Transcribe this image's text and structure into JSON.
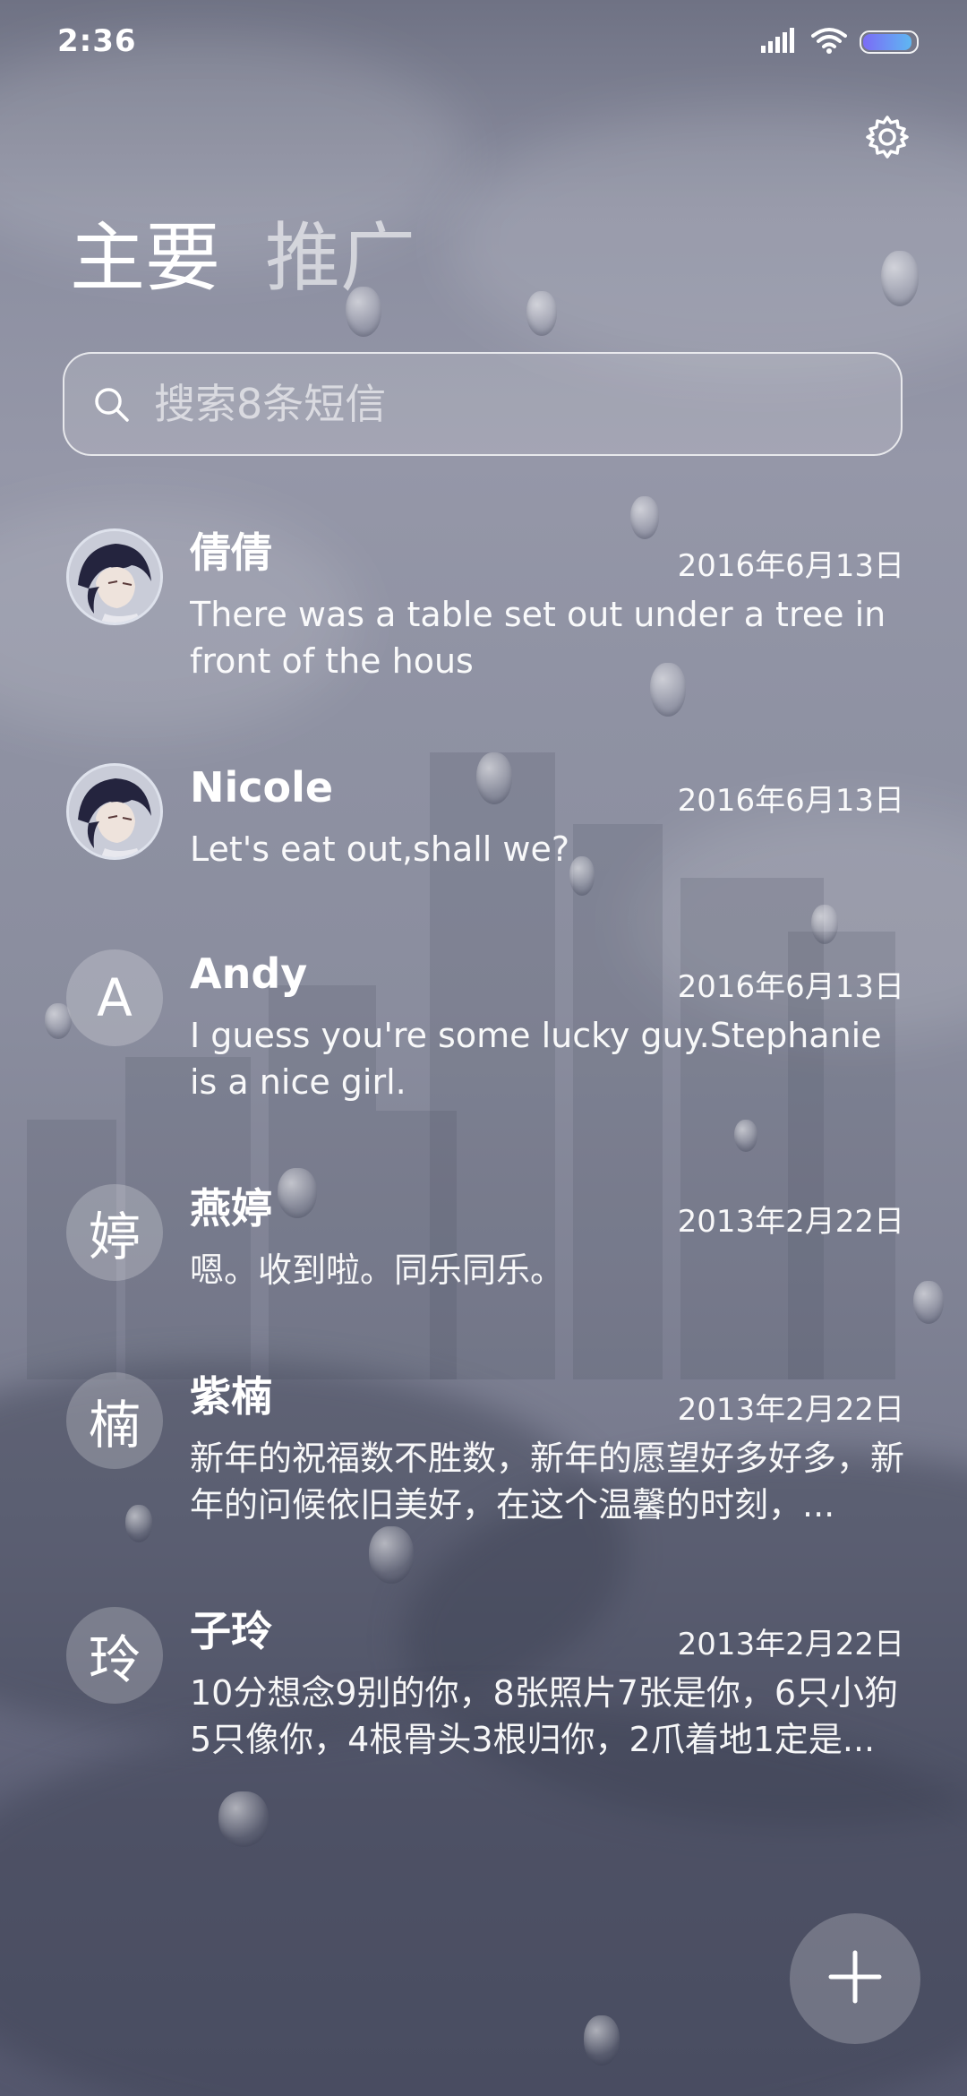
{
  "status_bar": {
    "time": "2:36"
  },
  "header": {
    "settings_icon": "gear-icon",
    "tabs": [
      {
        "label": "主要",
        "active": true
      },
      {
        "label": "推广",
        "active": false
      }
    ]
  },
  "search": {
    "placeholder": "搜索8条短信",
    "icon": "search-icon"
  },
  "conversations": [
    {
      "name": "倩倩",
      "date": "2016年6月13日",
      "preview": "There was a table set out under a tree in front of the hous",
      "avatar_type": "photo",
      "avatar_letter": ""
    },
    {
      "name": "Nicole",
      "date": "2016年6月13日",
      "preview": "Let's eat out,shall we?",
      "avatar_type": "photo",
      "avatar_letter": ""
    },
    {
      "name": "Andy",
      "date": "2016年6月13日",
      "preview": "I guess you're some lucky guy.Stephanie is a nice girl.",
      "avatar_type": "letter",
      "avatar_letter": "A"
    },
    {
      "name": "燕婷",
      "date": "2013年2月22日",
      "preview": "嗯。收到啦。同乐同乐。",
      "avatar_type": "letter",
      "avatar_letter": "婷"
    },
    {
      "name": "紫楠",
      "date": "2013年2月22日",
      "preview": "新年的祝福数不胜数，新年的愿望好多好多，新年的问候依旧美好，在这个温馨的时刻，...",
      "avatar_type": "letter",
      "avatar_letter": "楠"
    },
    {
      "name": "子玲",
      "date": "2013年2月22日",
      "preview": "10分想念9别的你，8张照片7张是你，6只小狗5只像你，4根骨头3根归你，2爪着地1定是...",
      "avatar_type": "letter",
      "avatar_letter": "玲"
    }
  ],
  "fab": {
    "icon": "plus-icon"
  },
  "colors": {
    "battery_gradient_start": "#7b6cf6",
    "battery_gradient_end": "#5fb7f2",
    "text": "#ffffff"
  }
}
